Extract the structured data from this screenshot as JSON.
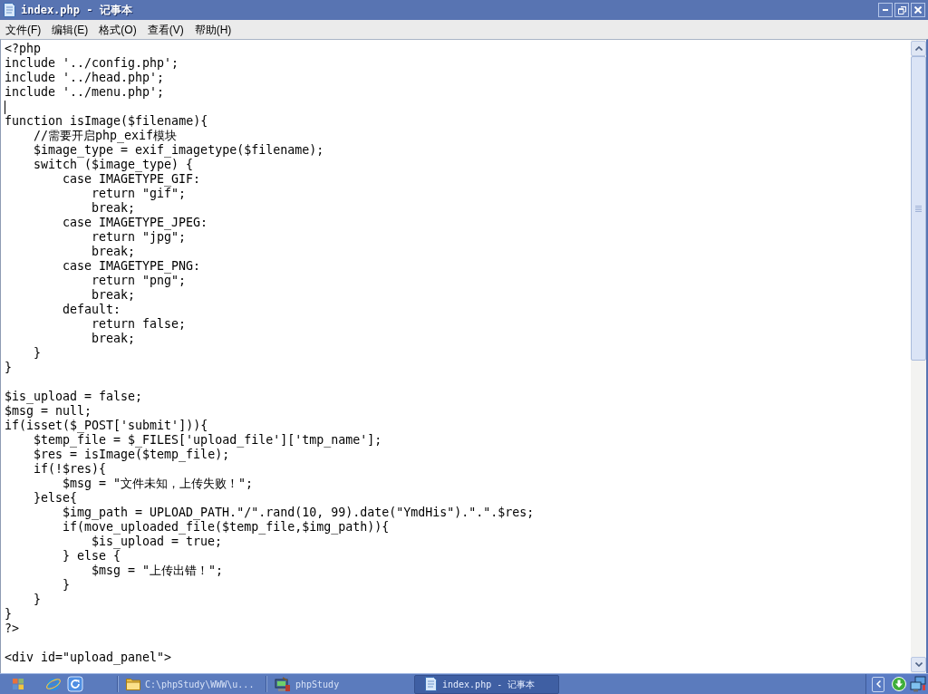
{
  "window": {
    "title": "index.php - 记事本"
  },
  "menu_bar": [
    "文件(F)",
    "编辑(E)",
    "格式(O)",
    "查看(V)",
    "帮助(H)"
  ],
  "editor": {
    "lines": [
      {
        "text": "<?php",
        "caret": false
      },
      {
        "text": "include '../config.php';",
        "caret": false
      },
      {
        "text": "include '../head.php';",
        "caret": false
      },
      {
        "text": "include '../menu.php';",
        "caret": false
      },
      {
        "caret": true
      },
      {
        "text": "function isImage($filename){",
        "caret": false
      },
      {
        "text": "    //需要开启php_exif模块",
        "caret": false
      },
      {
        "text": "    $image_type = exif_imagetype($filename);",
        "caret": false
      },
      {
        "text": "    switch ($image_type) {",
        "caret": false
      },
      {
        "text": "        case IMAGETYPE_GIF:",
        "caret": false
      },
      {
        "text": "            return \"gif\";",
        "caret": false
      },
      {
        "text": "            break;",
        "caret": false
      },
      {
        "text": "        case IMAGETYPE_JPEG:",
        "caret": false
      },
      {
        "text": "            return \"jpg\";",
        "caret": false
      },
      {
        "text": "            break;",
        "caret": false
      },
      {
        "text": "        case IMAGETYPE_PNG:",
        "caret": false
      },
      {
        "text": "            return \"png\";",
        "caret": false
      },
      {
        "text": "            break;",
        "caret": false
      },
      {
        "text": "        default:",
        "caret": false
      },
      {
        "text": "            return false;",
        "caret": false
      },
      {
        "text": "            break;",
        "caret": false
      },
      {
        "text": "    }",
        "caret": false
      },
      {
        "text": "}",
        "caret": false
      },
      {
        "caret": false
      },
      {
        "text": "$is_upload = false;",
        "caret": false
      },
      {
        "text": "$msg = null;",
        "caret": false
      },
      {
        "text": "if(isset($_POST['submit'])){",
        "caret": false
      },
      {
        "text": "    $temp_file = $_FILES['upload_file']['tmp_name'];",
        "caret": false
      },
      {
        "text": "    $res = isImage($temp_file);",
        "caret": false
      },
      {
        "text": "    if(!$res){",
        "caret": false
      },
      {
        "text": "        $msg = \"文件未知，上传失败！\";",
        "caret": false
      },
      {
        "text": "    }else{",
        "caret": false
      },
      {
        "text": "        $img_path = UPLOAD_PATH.\"/\".rand(10, 99).date(\"YmdHis\").\".\".$res;",
        "caret": false
      },
      {
        "text": "        if(move_uploaded_file($temp_file,$img_path)){",
        "caret": false
      },
      {
        "text": "            $is_upload = true;",
        "caret": false
      },
      {
        "text": "        } else {",
        "caret": false
      },
      {
        "text": "            $msg = \"上传出错！\";",
        "caret": false
      },
      {
        "text": "        }",
        "caret": false
      },
      {
        "text": "    }",
        "caret": false
      },
      {
        "text": "}",
        "caret": false
      },
      {
        "text": "?>",
        "caret": false
      },
      {
        "caret": false
      },
      {
        "text": "<div id=\"upload_panel\">",
        "caret": false
      }
    ]
  },
  "taskbar": {
    "tasks": [
      {
        "kind": "folder",
        "label": "C:\\phpStudy\\WWW\\u...",
        "selected": false
      },
      {
        "kind": "app",
        "label": "phpStudy",
        "selected": false
      },
      {
        "kind": "notepad",
        "label": "index.php - 记事本",
        "selected": true
      }
    ]
  }
}
